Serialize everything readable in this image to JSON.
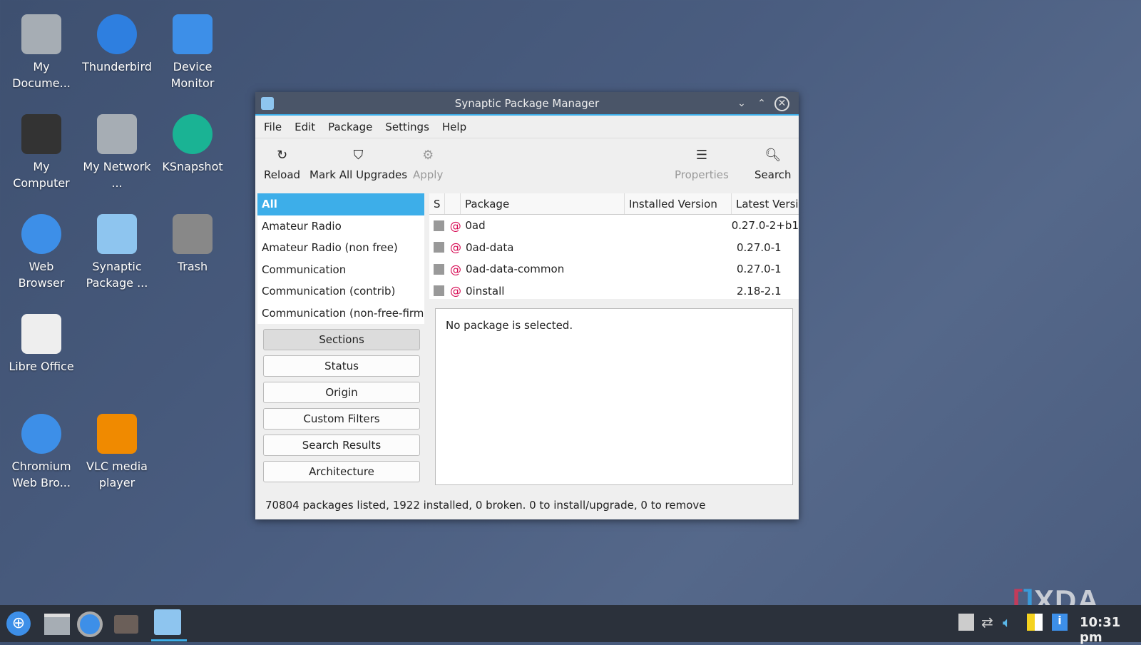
{
  "desktop": {
    "icons": [
      {
        "label": "My Docume...",
        "icon": "folder-documents-icon"
      },
      {
        "label": "Thunderbird",
        "icon": "thunderbird-icon"
      },
      {
        "label": "Device Monitor",
        "icon": "info-icon"
      },
      {
        "label": "My Computer",
        "icon": "computer-icon"
      },
      {
        "label": "My Network ...",
        "icon": "network-folder-icon"
      },
      {
        "label": "KSnapshot",
        "icon": "ksnapshot-icon"
      },
      {
        "label": "Web Browser",
        "icon": "web-browser-icon"
      },
      {
        "label": "Synaptic Package ...",
        "icon": "synaptic-icon"
      },
      {
        "label": "Trash",
        "icon": "trash-icon"
      },
      {
        "label": "Libre Office",
        "icon": "libreoffice-icon"
      },
      {
        "label": "Chromium Web Bro...",
        "icon": "chromium-icon"
      },
      {
        "label": "VLC media player",
        "icon": "vlc-icon"
      }
    ]
  },
  "window": {
    "title": "Synaptic Package Manager",
    "menu": [
      "File",
      "Edit",
      "Package",
      "Settings",
      "Help"
    ],
    "toolbar": {
      "reload": "Reload",
      "mark_all": "Mark All Upgrades",
      "apply": "Apply",
      "properties": "Properties",
      "search": "Search"
    },
    "sections": [
      "All",
      "Amateur Radio",
      "Amateur Radio (non free)",
      "Communication",
      "Communication (contrib)",
      "Communication (non-free-firmware)"
    ],
    "filters": [
      "Sections",
      "Status",
      "Origin",
      "Custom Filters",
      "Search Results",
      "Architecture"
    ],
    "columns": [
      "S",
      "",
      "Package",
      "Installed Version",
      "Latest Version"
    ],
    "packages": [
      {
        "name": "0ad",
        "installed": "",
        "latest": "0.27.0-2+b1"
      },
      {
        "name": "0ad-data",
        "installed": "",
        "latest": "0.27.0-1"
      },
      {
        "name": "0ad-data-common",
        "installed": "",
        "latest": "0.27.0-1"
      },
      {
        "name": "0install",
        "installed": "",
        "latest": "2.18-2.1"
      }
    ],
    "detail": "No package is selected.",
    "status": "70804 packages listed, 1922 installed, 0 broken. 0 to install/upgrade, 0 to remove"
  },
  "watermark": "XDA",
  "taskbar": {
    "clock": "10:31 pm"
  },
  "colors": {
    "accent": "#3daee9",
    "debian": "#d70a53"
  }
}
